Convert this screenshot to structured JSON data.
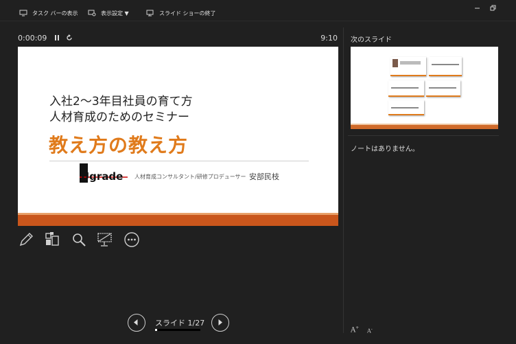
{
  "toolbar": {
    "taskbar_label": "タスク バーの表示",
    "display_settings_label": "表示設定 ▼",
    "end_show_label": "スライド ショーの終了"
  },
  "presenter": {
    "elapsed_time": "0:00:09",
    "clock": "9:10",
    "slide_counter": "スライド 1/27",
    "progress_fraction": 0.037
  },
  "current_slide": {
    "subtitle_line1": "入社2～3年目社員の育て方",
    "subtitle_line2": "人材育成のためのセミナー",
    "title": "教え方の教え方",
    "logo_text": "Ugrade",
    "presenter_role": "人材育成コンサルタント/研修プロデューサー",
    "presenter_name": "安部民枝",
    "accent_color": "#e07b1c",
    "band_color": "#c9561c"
  },
  "side_panel": {
    "next_slide_label": "次のスライド",
    "notes_text": "ノートはありません。",
    "font_increase": "A",
    "font_decrease": "A"
  },
  "icons": [
    "monitor-icon",
    "display-settings-icon",
    "end-show-icon",
    "minimize-icon",
    "restore-icon",
    "pause-icon",
    "restart-icon",
    "pen-icon",
    "all-slides-icon",
    "zoom-icon",
    "black-screen-icon",
    "more-options-icon",
    "previous-icon",
    "next-icon"
  ]
}
